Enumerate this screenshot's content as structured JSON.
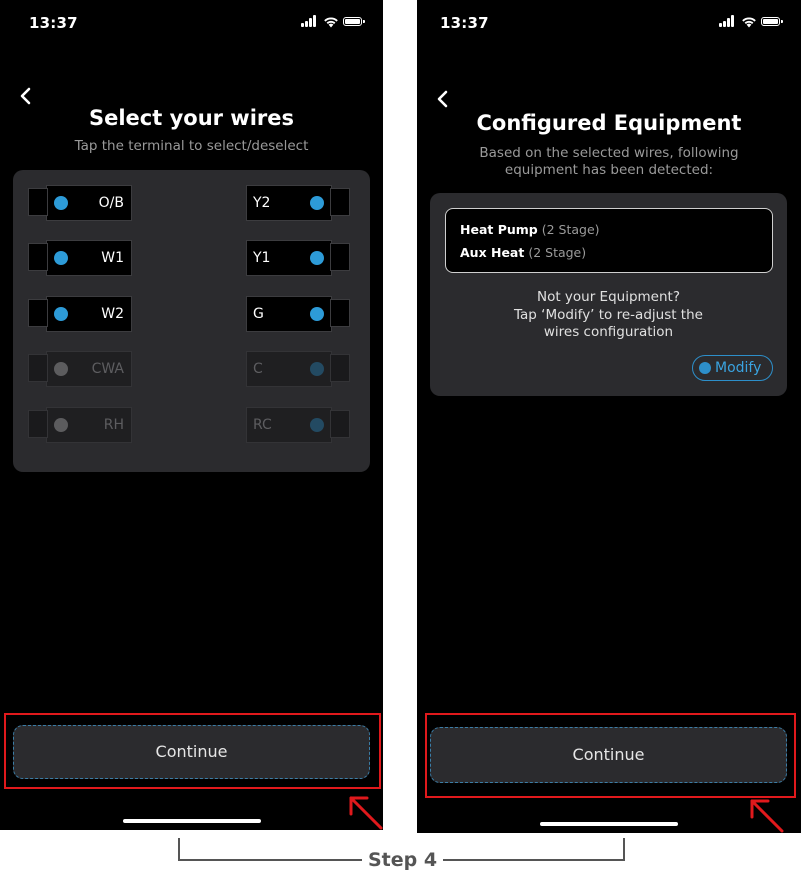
{
  "screens": [
    {
      "status_time": "13:37",
      "title": "Select your wires",
      "subtitle": "Tap the terminal to select/deselect",
      "left_terminals": [
        {
          "label": "O/B",
          "state": "selected"
        },
        {
          "label": "W1",
          "state": "selected"
        },
        {
          "label": "W2",
          "state": "selected"
        },
        {
          "label": "CWA",
          "state": "disabled"
        },
        {
          "label": "RH",
          "state": "disabled"
        }
      ],
      "right_terminals": [
        {
          "label": "Y2",
          "state": "selected"
        },
        {
          "label": "Y1",
          "state": "selected"
        },
        {
          "label": "G",
          "state": "selected"
        },
        {
          "label": "C",
          "state": "disabled"
        },
        {
          "label": "RC",
          "state": "disabled"
        }
      ],
      "continue_label": "Continue"
    },
    {
      "status_time": "13:37",
      "title": "Configured Equipment",
      "subtitle_line1": "Based on the selected wires, following",
      "subtitle_line2": "equipment has been detected:",
      "equipment": [
        {
          "name": "Heat Pump",
          "stage": "(2 Stage)"
        },
        {
          "name": "Aux Heat",
          "stage": "(2 Stage)"
        }
      ],
      "hint_line1": "Not your Equipment?",
      "hint_line2": "Tap ‘Modify’ to re-adjust the",
      "hint_line3": "wires configuration",
      "modify_label": "Modify",
      "continue_label": "Continue"
    }
  ],
  "step_label": "Step 4",
  "colors": {
    "accent_blue": "#2d9bd8",
    "highlight_red": "#e0191c",
    "panel": "#2b2b2e",
    "background": "#000000"
  },
  "icons": [
    "back-chevron-icon",
    "signal-icon",
    "wifi-icon",
    "battery-icon",
    "annotation-arrow-icon",
    "modify-icon"
  ]
}
